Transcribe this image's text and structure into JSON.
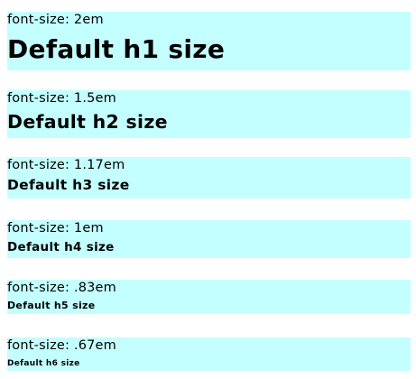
{
  "blocks": [
    {
      "size_label": "font-size: 2em",
      "heading": "Default h1 size"
    },
    {
      "size_label": "font-size: 1.5em",
      "heading": "Default h2 size"
    },
    {
      "size_label": "font-size: 1.17em",
      "heading": "Default h3 size"
    },
    {
      "size_label": "font-size: 1em",
      "heading": "Default h4 size"
    },
    {
      "size_label": "font-size: .83em",
      "heading": "Default h5 size"
    },
    {
      "size_label": "font-size: .67em",
      "heading": "Default h6 size"
    }
  ],
  "colors": {
    "block_background": "#c4ffff",
    "text": "#000000",
    "page_background": "#ffffff"
  }
}
